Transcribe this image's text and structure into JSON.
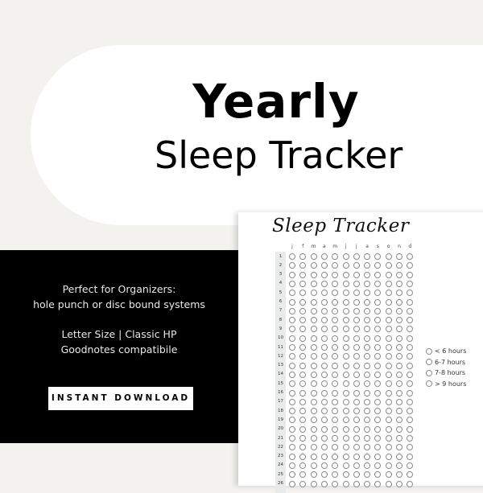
{
  "header": {
    "title_bold": "Yearly",
    "title_light": "Sleep Tracker"
  },
  "promo": {
    "lines": [
      "Perfect for Organizers:",
      "hole punch or disc bound systems",
      "Letter Size | Classic HP",
      "Goodnotes compatibile"
    ],
    "button_label": "INSTANT DOWNLOAD"
  },
  "tracker": {
    "title": "Sleep Tracker",
    "months": [
      "j",
      "f",
      "m",
      "a",
      "m",
      "j",
      "j",
      "a",
      "s",
      "o",
      "n",
      "d"
    ],
    "days_visible": [
      "1",
      "2",
      "3",
      "4",
      "5",
      "6",
      "7",
      "8",
      "9",
      "10",
      "11",
      "12",
      "13",
      "14",
      "15",
      "16",
      "17",
      "18",
      "19",
      "20",
      "21",
      "22",
      "23",
      "24",
      "25",
      "26"
    ],
    "legend": [
      "< 6 hours",
      "6-7 hours",
      "7-8 hours",
      "> 9 hours"
    ]
  },
  "colors": {
    "background": "#f4f2ee",
    "panel": "#000000",
    "card": "#ffffff"
  }
}
